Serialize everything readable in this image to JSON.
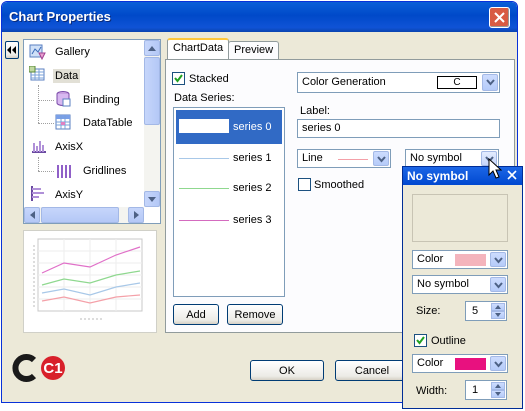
{
  "window": {
    "title": "Chart Properties"
  },
  "tree": {
    "items": [
      {
        "label": "Gallery"
      },
      {
        "label": "Data"
      },
      {
        "label": "Binding"
      },
      {
        "label": "DataTable"
      },
      {
        "label": "AxisX"
      },
      {
        "label": "Gridlines"
      },
      {
        "label": "AxisY"
      }
    ]
  },
  "tabs": [
    {
      "label": "ChartData"
    },
    {
      "label": "Preview"
    }
  ],
  "chartdata": {
    "stacked_label": "Stacked",
    "stacked_checked": true,
    "series_header": "Data Series:",
    "series": [
      {
        "label": "series 0",
        "color": "#ffffff"
      },
      {
        "label": "series 1",
        "color": "#a8c8e8"
      },
      {
        "label": "series 2",
        "color": "#8fd88f"
      },
      {
        "label": "series 3",
        "color": "#d46bbf"
      }
    ],
    "color_generation": {
      "label": "Color Generation",
      "value": "C"
    },
    "label_caption": "Label:",
    "label_value": "series 0",
    "line_style": "Line",
    "line_color": "#f4a0a8",
    "symbol": "No symbol",
    "smoothed_label": "Smoothed",
    "add_label": "Add",
    "remove_label": "Remove"
  },
  "footer": {
    "logo_text": "C1",
    "ok_label": "OK",
    "cancel_label": "Cancel"
  },
  "popup": {
    "title": "No symbol",
    "color_label": "Color",
    "color_swatch": "#f4b4bc",
    "symbol_value": "No symbol",
    "size_label": "Size:",
    "size_value": "5",
    "outline_label": "Outline",
    "outline_checked": true,
    "outline_color_label": "Color",
    "outline_swatch": "#e8117f",
    "width_label": "Width:",
    "width_value": "1"
  }
}
